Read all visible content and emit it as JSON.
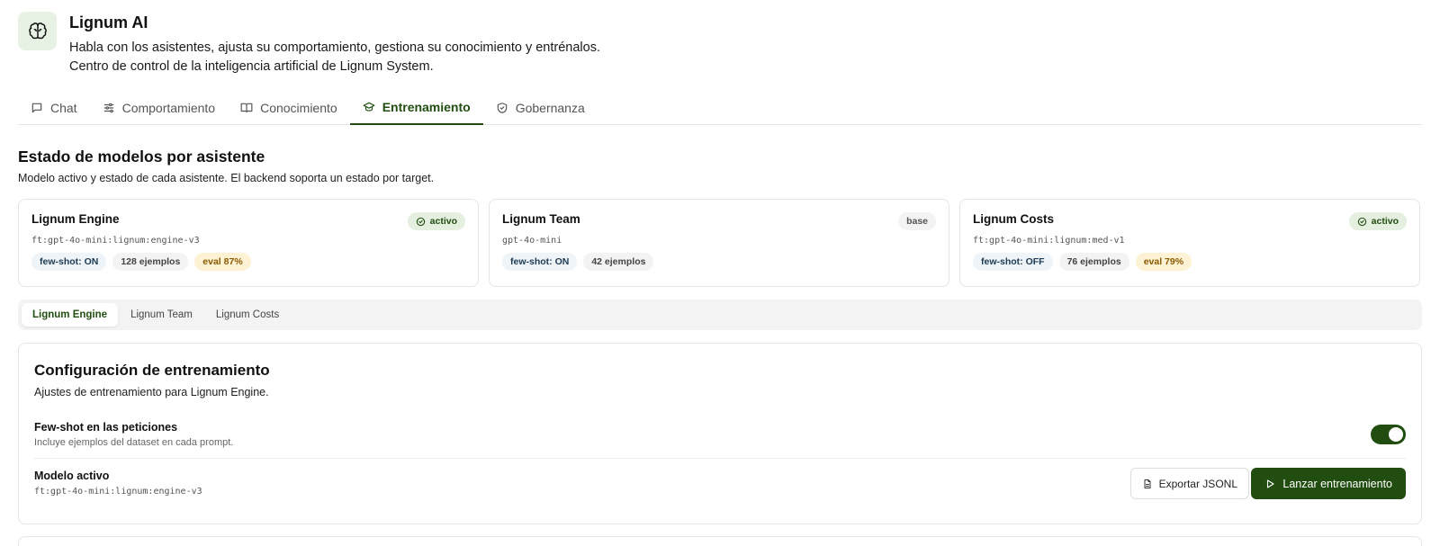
{
  "app": {
    "title": "Lignum AI",
    "subtitle_line1": "Habla con los asistentes, ajusta su comportamiento, gestiona su conocimiento y entrénalos.",
    "subtitle_line2": "Centro de control de la inteligencia artificial de Lignum System.",
    "logo_icon": "brain-icon"
  },
  "tabs": [
    {
      "label": "Chat",
      "icon": "message-icon"
    },
    {
      "label": "Comportamiento",
      "icon": "sliders-icon"
    },
    {
      "label": "Conocimiento",
      "icon": "book-icon"
    },
    {
      "label": "Entrenamiento",
      "icon": "graduation-cap-icon",
      "active": true
    },
    {
      "label": "Gobernanza",
      "icon": "shield-icon"
    }
  ],
  "section": {
    "title": "Estado de modelos por asistente",
    "description": "Modelo activo y estado de cada asistente. El backend soporta un estado por target."
  },
  "cards": [
    {
      "name": "Lignum Engine",
      "status": "activo",
      "model": "ft:gpt-4o-mini:lignum:engine-v3",
      "fewshot": "few-shot: ON",
      "examples": "128 ejemplos",
      "eval": "eval 87%"
    },
    {
      "name": "Lignum Team",
      "status": "base",
      "model": "gpt-4o-mini",
      "fewshot": "few-shot: ON",
      "examples": "42 ejemplos"
    },
    {
      "name": "Lignum Costs",
      "status": "activo",
      "model": "ft:gpt-4o-mini:lignum:med-v1",
      "fewshot": "few-shot: OFF",
      "examples": "76 ejemplos",
      "eval": "eval 79%"
    }
  ],
  "subtabs": [
    {
      "label": "Lignum Engine",
      "active": true
    },
    {
      "label": "Lignum Team"
    },
    {
      "label": "Lignum Costs"
    }
  ],
  "config": {
    "title": "Configuración de entrenamiento",
    "description": "Ajustes de entrenamiento para Lignum Engine.",
    "fewshot_title": "Few-shot en las peticiones",
    "fewshot_sub": "Incluye ejemplos del dataset en cada prompt.",
    "fewshot_enabled": true,
    "model_title": "Modelo activo",
    "model_value": "ft:gpt-4o-mini:lignum:engine-v3",
    "export_label": "Exportar JSONL",
    "launch_label": "Lanzar entrenamiento"
  },
  "colors": {
    "accent": "#214d10",
    "accent_light": "#e4efdf",
    "eval_bg": "#fdf2d4"
  }
}
